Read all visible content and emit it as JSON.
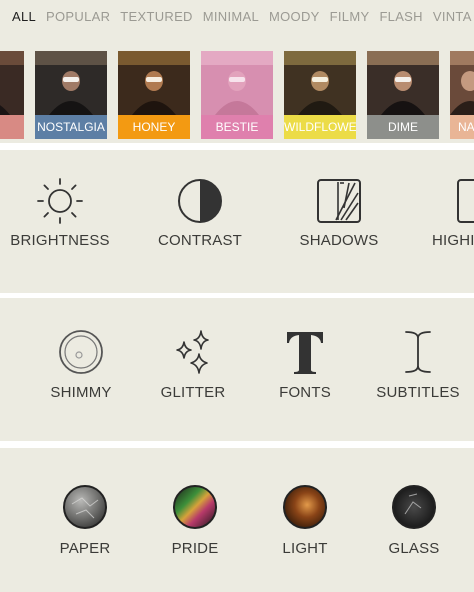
{
  "tabs": [
    {
      "label": "ALL",
      "active": true
    },
    {
      "label": "POPULAR",
      "active": false
    },
    {
      "label": "TEXTURED",
      "active": false
    },
    {
      "label": "MINIMAL",
      "active": false
    },
    {
      "label": "MOODY",
      "active": false
    },
    {
      "label": "FILMY",
      "active": false
    },
    {
      "label": "FLASH",
      "active": false
    },
    {
      "label": "VINTA",
      "active": false
    }
  ],
  "filters": [
    {
      "label": "R",
      "color": "#d88a84"
    },
    {
      "label": "NOSTALGIA",
      "color": "#5d7fa5"
    },
    {
      "label": "HONEY",
      "color": "#f39a12"
    },
    {
      "label": "BESTIE",
      "color": "#df80ad"
    },
    {
      "label": "WILDFLOWER",
      "color": "#ecdc47"
    },
    {
      "label": "DIME",
      "color": "#8d8f8b"
    },
    {
      "label": "NA",
      "color": "#e9b596"
    }
  ],
  "adjust_tools": [
    {
      "label": "BRIGHTNESS",
      "icon": "sun-icon"
    },
    {
      "label": "CONTRAST",
      "icon": "contrast-icon"
    },
    {
      "label": "SHADOWS",
      "icon": "shadows-icon"
    },
    {
      "label": "HIGHI",
      "icon": "highlights-icon"
    }
  ],
  "effect_tools": [
    {
      "label": "SHIMMY",
      "icon": "shimmy-icon"
    },
    {
      "label": "GLITTER",
      "icon": "sparkles-icon"
    },
    {
      "label": "FONTS",
      "icon": "serif-t-icon"
    },
    {
      "label": "SUBTITLES",
      "icon": "text-cursor-icon"
    }
  ],
  "overlay_tools": [
    {
      "label": "PAPER",
      "icon": "paper-texture-icon"
    },
    {
      "label": "PRIDE",
      "icon": "prism-texture-icon"
    },
    {
      "label": "LIGHT",
      "icon": "light-leak-icon"
    },
    {
      "label": "GLASS",
      "icon": "glass-texture-icon"
    }
  ]
}
